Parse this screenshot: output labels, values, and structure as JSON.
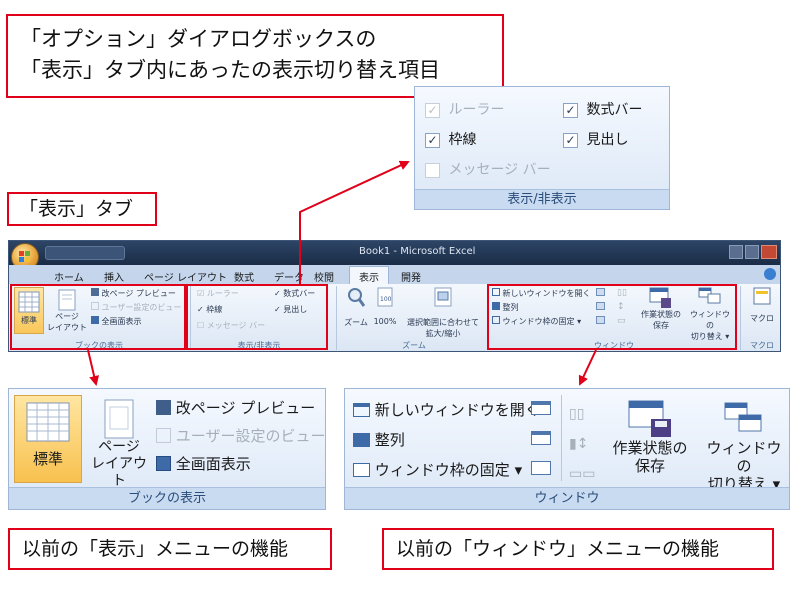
{
  "callouts": {
    "top": {
      "line1": "「オプション」ダイアログボックスの",
      "line2": "「表示」タブ内にあったの表示切り替え項目"
    },
    "view_tab": "「表示」タブ",
    "bottom_left": "以前の「表示」メニューの機能",
    "bottom_right": "以前の「ウィンドウ」メニューの機能"
  },
  "show_hide_panel": {
    "ruler": "ルーラー",
    "formula_bar": "数式バー",
    "gridlines": "枠線",
    "headings": "見出し",
    "message_bar": "メッセージ バー",
    "caption": "表示/非表示"
  },
  "excel": {
    "title": "Book1 - Microsoft Excel",
    "tabs": [
      "ホーム",
      "挿入",
      "ページ レイアウト",
      "数式",
      "データ",
      "校閲",
      "表示",
      "開発"
    ],
    "active_tab": "表示",
    "small": {
      "normal": "標準",
      "page_layout_1": "ページ",
      "page_layout_2": "レイアウト",
      "page_break": "改ページ プレビュー",
      "custom_views": "ユーザー設定のビュー",
      "full_screen": "全画面表示",
      "group_book": "ブックの表示",
      "ruler": "ルーラー",
      "formula_bar": "数式バー",
      "gridlines": "枠線",
      "headings": "見出し",
      "message_bar": "メッセージ バー",
      "group_showhide": "表示/非表示",
      "zoom": "ズーム",
      "zoom100": "100%",
      "zoom_sel_1": "選択範囲に合わせて",
      "zoom_sel_2": "拡大/縮小",
      "group_zoom": "ズーム",
      "new_window": "新しいウィンドウを開く",
      "arrange": "整列",
      "freeze": "ウィンドウ枠の固定",
      "save_ws_1": "作業状態の",
      "save_ws_2": "保存",
      "switch_1": "ウィンドウの",
      "switch_2": "切り替え",
      "group_window": "ウィンドウ",
      "macro": "マクロ",
      "group_macro": "マクロ"
    }
  },
  "book_zoom": {
    "normal": "標準",
    "page_layout_1": "ページ",
    "page_layout_2": "レイアウト",
    "page_break": "改ページ プレビュー",
    "custom_views": "ユーザー設定のビュー",
    "full_screen": "全画面表示",
    "caption": "ブックの表示"
  },
  "window_zoom": {
    "new_window": "新しいウィンドウを開く",
    "arrange": "整列",
    "freeze": "ウィンドウ枠の固定",
    "save_ws_1": "作業状態の",
    "save_ws_2": "保存",
    "switch_1": "ウィンドウの",
    "switch_2": "切り替え",
    "caption": "ウィンドウ"
  },
  "colors": {
    "accent_red": "#e0001a",
    "ribbon_blue": "#c9dbf1",
    "titlebar": "#1f3350"
  }
}
